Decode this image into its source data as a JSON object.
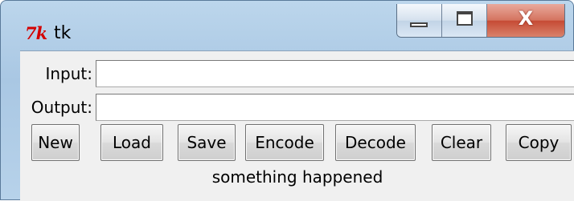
{
  "window": {
    "title": "tk",
    "logo_text": "7k"
  },
  "form": {
    "input_label": "Input:",
    "input_value": "",
    "output_label": "Output:",
    "output_value": ""
  },
  "buttons": {
    "new": "New",
    "load": "Load",
    "save": "Save",
    "encode": "Encode",
    "decode": "Decode",
    "clear": "Clear",
    "copy": "Copy"
  },
  "status": {
    "text": "something happened"
  },
  "caption": {
    "close_glyph": "X"
  }
}
